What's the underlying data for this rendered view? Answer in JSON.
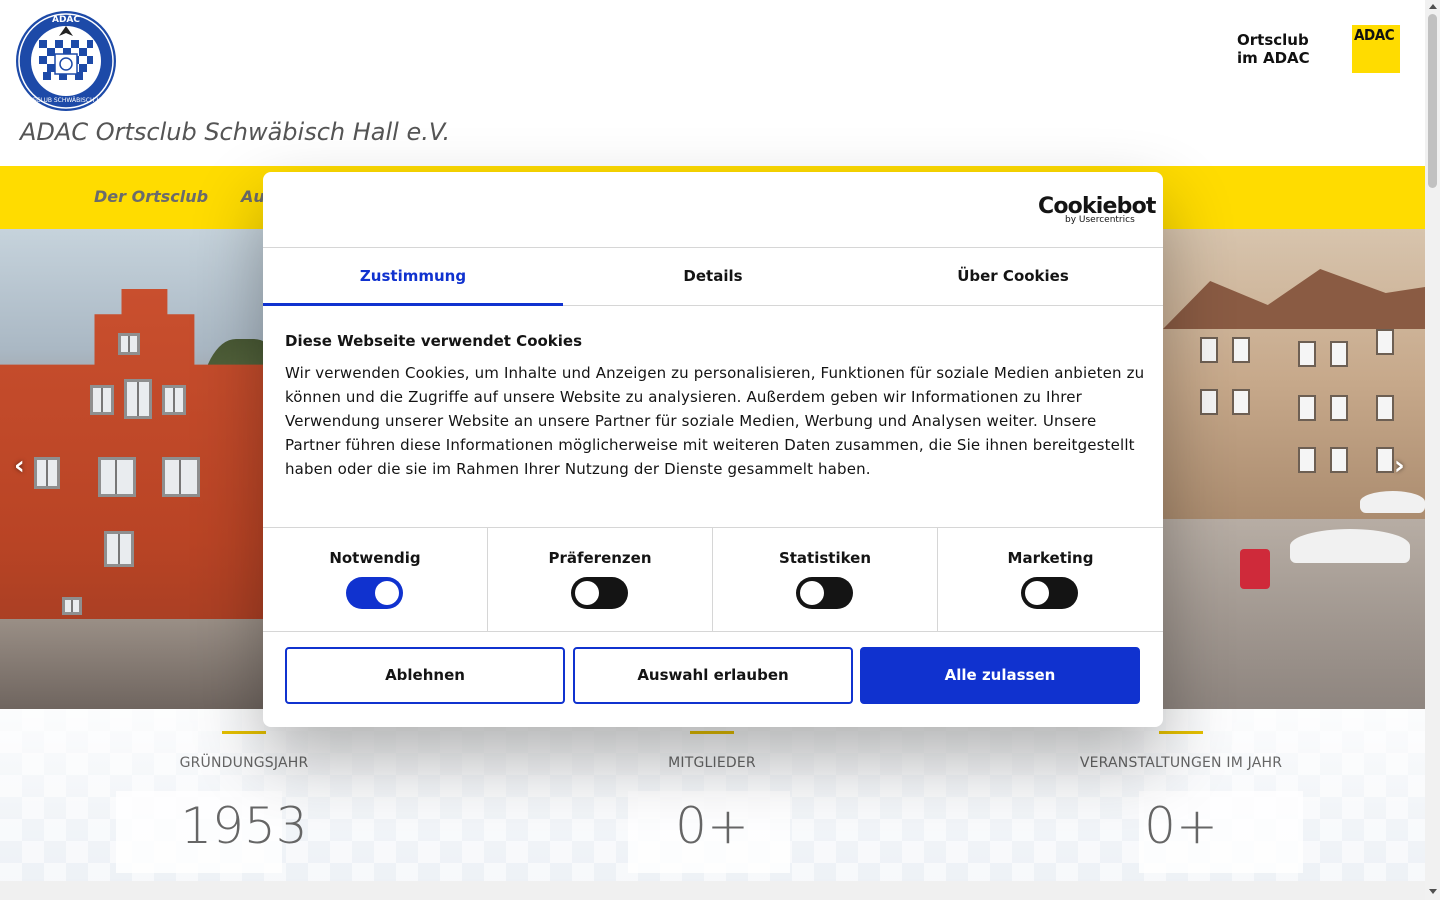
{
  "header": {
    "logo_alt": "ADAC Ortsclub Schwäbisch Hall",
    "logo_text_top": "ADAC",
    "logo_text_ring": "ORTSCLUB SCHWÄBISCH HALL",
    "site_title": "ADAC Ortsclub Schwäbisch Hall e.V.",
    "ortsclub_line1": "Ortsclub",
    "ortsclub_line2": "im ADAC",
    "adac_logo_text": "ADAC"
  },
  "nav": {
    "items": [
      {
        "label": "Der Ortsclub"
      },
      {
        "label": "Au"
      }
    ]
  },
  "hero": {
    "prev_arrow": "‹",
    "next_arrow": "›"
  },
  "stats": [
    {
      "label": "GRÜNDUNGSJAHR",
      "value": "1953"
    },
    {
      "label": "MITGLIEDER",
      "value": "0+"
    },
    {
      "label": "VERANSTALTUNGEN IM JAHR",
      "value": "0+"
    }
  ],
  "cookie": {
    "brand": "Cookiebot",
    "brand_sub": "by Usercentrics",
    "tabs": [
      {
        "label": "Zustimmung",
        "active": true
      },
      {
        "label": "Details",
        "active": false
      },
      {
        "label": "Über Cookies",
        "active": false
      }
    ],
    "heading": "Diese Webseite verwendet Cookies",
    "text": "Wir verwenden Cookies, um Inhalte und Anzeigen zu personalisieren, Funktionen für soziale Medien anbieten zu können und die Zugriffe auf unsere Website zu analysieren. Außerdem geben wir Informationen zu Ihrer Verwendung unserer Website an unsere Partner für soziale Medien, Werbung und Analysen weiter. Unsere Partner führen diese Informationen möglicherweise mit weiteren Daten zusammen, die Sie ihnen bereitgestellt haben oder die sie im Rahmen Ihrer Nutzung der Dienste gesammelt haben.",
    "categories": [
      {
        "label": "Notwendig",
        "enabled": true
      },
      {
        "label": "Präferenzen",
        "enabled": false
      },
      {
        "label": "Statistiken",
        "enabled": false
      },
      {
        "label": "Marketing",
        "enabled": false
      }
    ],
    "buttons": {
      "decline": "Ablehnen",
      "allow_selection": "Auswahl erlauben",
      "allow_all": "Alle zulassen"
    }
  },
  "colors": {
    "adac_yellow": "#ffdc00",
    "cookiebot_blue": "#1032cf",
    "club_blue": "#1d4aa8"
  }
}
